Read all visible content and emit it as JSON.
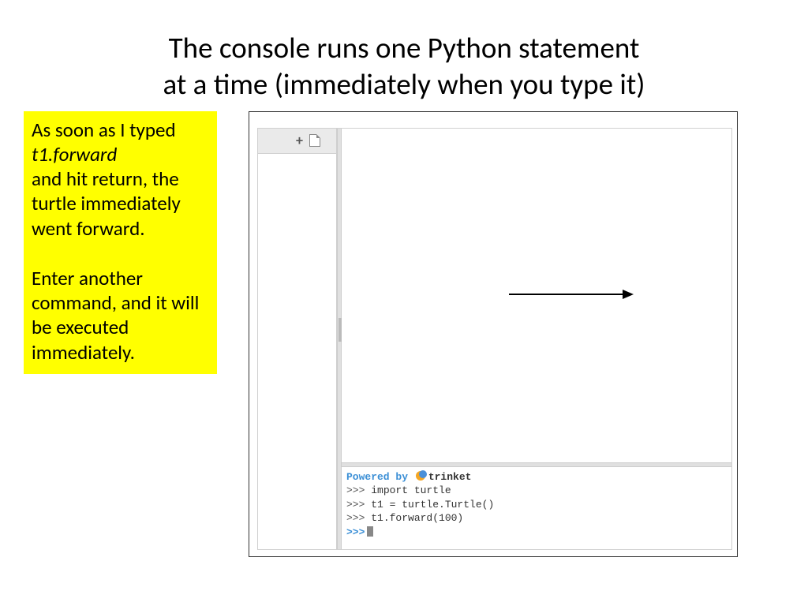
{
  "title_line1": "The console runs one Python statement",
  "title_line2": "at a time (immediately when you type it)",
  "note": {
    "line1": "As soon as I typed",
    "line2_italic": "t1.forward",
    "line3": "and hit return, the turtle immediately went forward.",
    "line4": "Enter another command, and it will be executed immediately."
  },
  "console": {
    "powered_by": "Powered by",
    "brand": "trinket",
    "prompt": ">>>",
    "lines": [
      "import turtle",
      "t1 = turtle.Turtle()",
      "t1.forward(100)"
    ]
  }
}
